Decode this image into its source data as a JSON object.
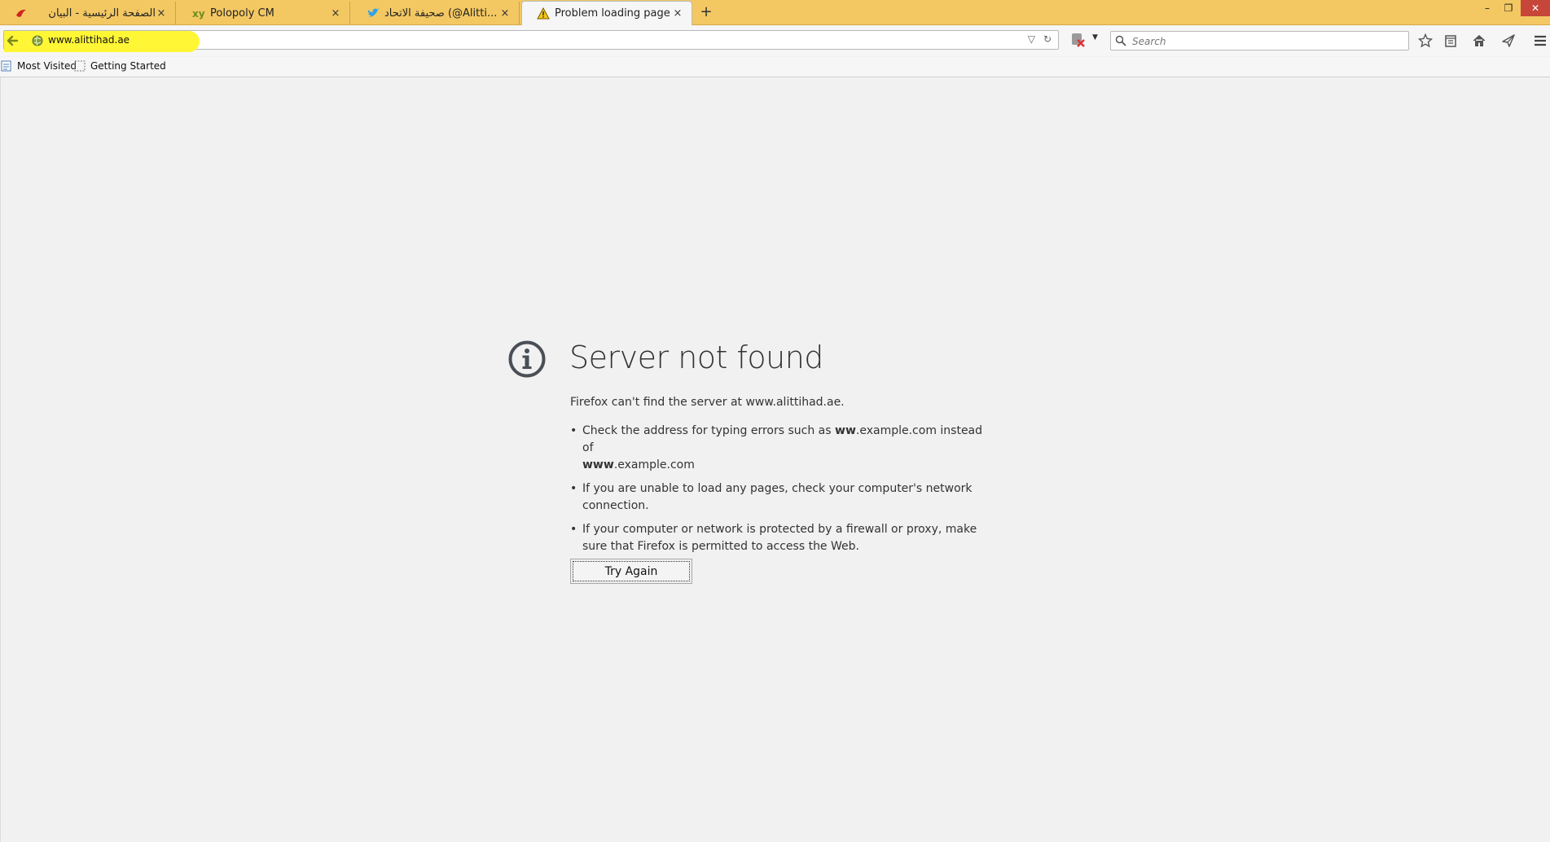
{
  "tabs": [
    {
      "label": "الصفحة الرئيسية - البيان",
      "icon": "albayan-favicon"
    },
    {
      "label": "Polopoly CM",
      "icon": "polopoly-favicon"
    },
    {
      "label": "صحيفة الاتحاد (@Alitti...",
      "icon": "twitter-favicon"
    },
    {
      "label": "Problem loading page",
      "icon": "warning-favicon",
      "active": true
    }
  ],
  "tab_close": "×",
  "new_tab": "+",
  "window": {
    "minimize": "–",
    "restore": "❐",
    "close": "✕"
  },
  "url": "www.alittihad.ae",
  "search": {
    "placeholder": "Search"
  },
  "bookmarks": [
    {
      "label": "Most Visited",
      "icon": "most-visited-icon"
    },
    {
      "label": "Getting Started",
      "icon": "bookmark-page-icon"
    }
  ],
  "error": {
    "title": "Server not found",
    "description": "Firefox can't find the server at www.alittihad.ae.",
    "items": [
      {
        "parts": [
          {
            "text": "Check the address for typing errors such as ",
            "bold": false
          },
          {
            "text": "ww",
            "bold": true
          },
          {
            "text": ".example.com instead of ",
            "bold": false
          },
          {
            "text": "www",
            "bold": true
          },
          {
            "text": ".example.com",
            "bold": false
          }
        ]
      },
      {
        "parts": [
          {
            "text": "If you are unable to load any pages, check your computer's network connection.",
            "bold": false
          }
        ]
      },
      {
        "parts": [
          {
            "text": "If your computer or network is protected by a firewall or proxy, make sure that Firefox is permitted to access the Web.",
            "bold": false
          }
        ]
      }
    ],
    "button": "Try Again"
  },
  "colors": {
    "tabbar": "#f3c863",
    "url_highlight": "#fff62b",
    "text": "#333333"
  }
}
